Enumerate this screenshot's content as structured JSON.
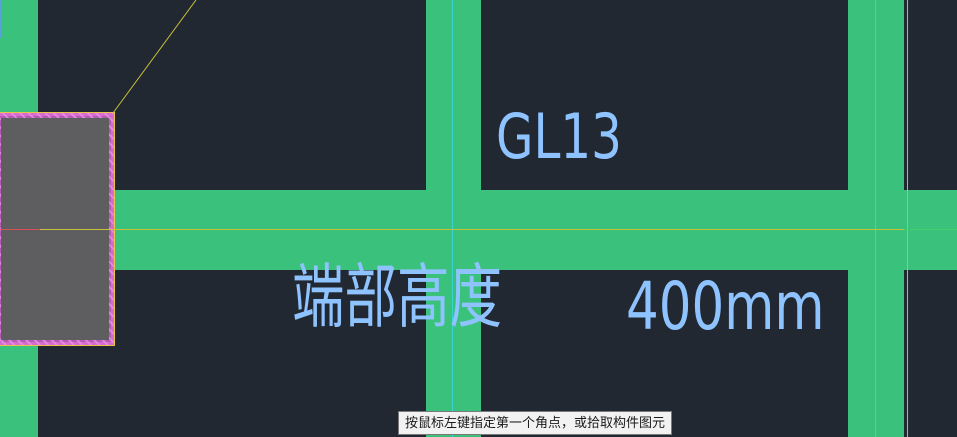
{
  "viewport": {
    "background": "#222831",
    "beam_color": "#3ac27d",
    "column_fill": "#5e5e60",
    "column_border": "#d86ad0",
    "guide_yellow": "#c8c23a",
    "guide_cyan": "#37d6d0",
    "label_color": "#8fc3ff"
  },
  "labels": {
    "beam_name": "GL13",
    "end_height_label": "端部高度",
    "end_height_value": "400mm"
  },
  "status": {
    "tip": "按鼠标左键指定第一个角点，或拾取构件图元"
  }
}
